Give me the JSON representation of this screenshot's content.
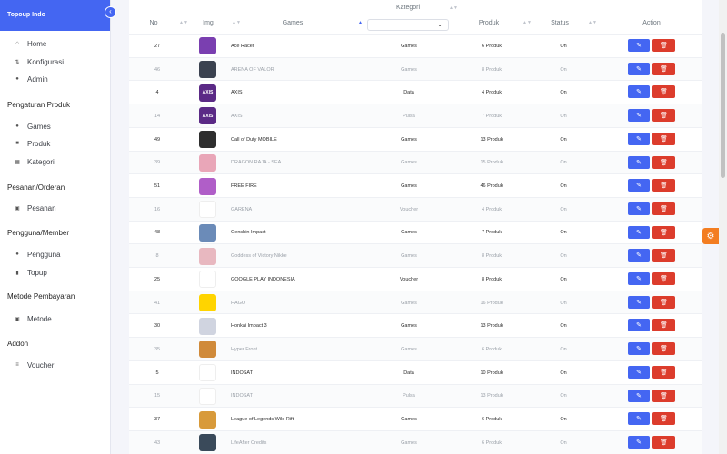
{
  "brand": "Topoup Indo",
  "collapse_icon": "chevron-left-icon",
  "nav": {
    "home": "Home",
    "konfigurasi": "Konfigurasi",
    "admin": "Admin",
    "section_produk": "Pengaturan Produk",
    "games": "Games",
    "produk": "Produk",
    "kategori": "Kategori",
    "section_pesanan": "Pesanan/Orderan",
    "pesanan": "Pesanan",
    "section_member": "Pengguna/Member",
    "pengguna": "Pengguna",
    "topup": "Topup",
    "section_pembayaran": "Metode Pembayaran",
    "metode": "Metode",
    "section_addon": "Addon",
    "voucher": "Voucher"
  },
  "table": {
    "headers": {
      "no": "No",
      "img": "Img",
      "games": "Games",
      "kategori": "Kategori",
      "produk": "Produk",
      "status": "Status",
      "action": "Action"
    },
    "kategori_filter_value": "",
    "rows": [
      {
        "no": "27",
        "game": "Ace Racer",
        "kategori": "Games",
        "produk": "6 Produk",
        "status": "On",
        "thumb_color": "#7a3fb0",
        "thumb_text": ""
      },
      {
        "no": "46",
        "game": "ARENA OF VALOR",
        "kategori": "Games",
        "produk": "8 Produk",
        "status": "On",
        "thumb_color": "#3b4250",
        "thumb_text": ""
      },
      {
        "no": "4",
        "game": "AXIS",
        "kategori": "Data",
        "produk": "4 Produk",
        "status": "On",
        "thumb_color": "#5b2a86",
        "thumb_text": "AXIS"
      },
      {
        "no": "14",
        "game": "AXIS",
        "kategori": "Pulsa",
        "produk": "7 Produk",
        "status": "On",
        "thumb_color": "#5b2a86",
        "thumb_text": "AXIS"
      },
      {
        "no": "49",
        "game": "Call of Duty MOBILE",
        "kategori": "Games",
        "produk": "13 Produk",
        "status": "On",
        "thumb_color": "#2e2e2e",
        "thumb_text": ""
      },
      {
        "no": "39",
        "game": "DRAGON RAJA - SEA",
        "kategori": "Games",
        "produk": "15 Produk",
        "status": "On",
        "thumb_color": "#e9a6b8",
        "thumb_text": ""
      },
      {
        "no": "51",
        "game": "FREE FIRE",
        "kategori": "Games",
        "produk": "46 Produk",
        "status": "On",
        "thumb_color": "#b05ec8",
        "thumb_text": ""
      },
      {
        "no": "16",
        "game": "GARENA",
        "kategori": "Voucher",
        "produk": "4 Produk",
        "status": "On",
        "thumb_color": "#ffffff",
        "thumb_text": ""
      },
      {
        "no": "48",
        "game": "Genshin Impact",
        "kategori": "Games",
        "produk": "7 Produk",
        "status": "On",
        "thumb_color": "#6b8bb8",
        "thumb_text": ""
      },
      {
        "no": "8",
        "game": "Goddess of Victory Nikke",
        "kategori": "Games",
        "produk": "8 Produk",
        "status": "On",
        "thumb_color": "#e8b8c0",
        "thumb_text": ""
      },
      {
        "no": "25",
        "game": "GOOGLE PLAY INDONESIA",
        "kategori": "Voucher",
        "produk": "8 Produk",
        "status": "On",
        "thumb_color": "#ffffff",
        "thumb_text": ""
      },
      {
        "no": "41",
        "game": "HAGO",
        "kategori": "Games",
        "produk": "16 Produk",
        "status": "On",
        "thumb_color": "#ffd400",
        "thumb_text": ""
      },
      {
        "no": "30",
        "game": "Honkai Impact 3",
        "kategori": "Games",
        "produk": "13 Produk",
        "status": "On",
        "thumb_color": "#d0d4e0",
        "thumb_text": ""
      },
      {
        "no": "35",
        "game": "Hyper Front",
        "kategori": "Games",
        "produk": "6 Produk",
        "status": "On",
        "thumb_color": "#d08a3a",
        "thumb_text": ""
      },
      {
        "no": "5",
        "game": "INDOSAT",
        "kategori": "Data",
        "produk": "10 Produk",
        "status": "On",
        "thumb_color": "#ffffff",
        "thumb_text": ""
      },
      {
        "no": "15",
        "game": "INDOSAT",
        "kategori": "Pulsa",
        "produk": "13 Produk",
        "status": "On",
        "thumb_color": "#ffffff",
        "thumb_text": ""
      },
      {
        "no": "37",
        "game": "League of Legends Wild Rift",
        "kategori": "Games",
        "produk": "6 Produk",
        "status": "On",
        "thumb_color": "#d89a3a",
        "thumb_text": ""
      },
      {
        "no": "43",
        "game": "LifeAfter Credits",
        "kategori": "Games",
        "produk": "6 Produk",
        "status": "On",
        "thumb_color": "#3a4a5a",
        "thumb_text": ""
      }
    ]
  },
  "colors": {
    "primary": "#4466f2",
    "danger": "#dc3c2c",
    "settings": "#f37d21"
  },
  "icons": {
    "edit": "edit-icon",
    "delete": "trash-icon",
    "settings": "gear-icon"
  }
}
